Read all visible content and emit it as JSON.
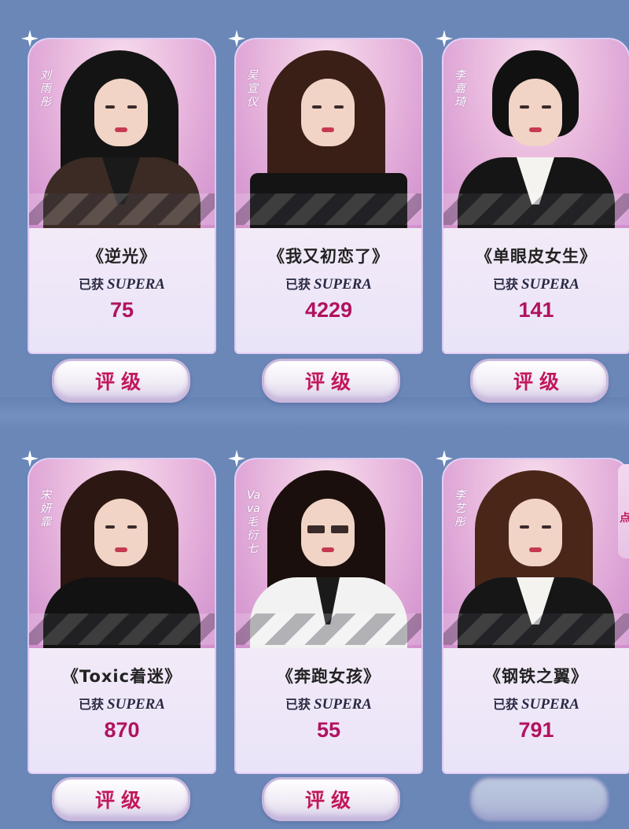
{
  "cards": [
    {
      "name": "刘雨彤",
      "song": "《逆光》",
      "got_label": "已获",
      "badge": "SUPERA",
      "count": "75",
      "button": "评级"
    },
    {
      "name": "吴宣仪",
      "song": "《我又初恋了》",
      "got_label": "已获",
      "badge": "SUPERA",
      "count": "4229",
      "button": "评级"
    },
    {
      "name": "李嘉琦",
      "song": "《单眼皮女生》",
      "got_label": "已获",
      "badge": "SUPERA",
      "count": "141",
      "button": "评级"
    },
    {
      "name": "宋妍霏",
      "song": "《Toxic着迷》",
      "got_label": "已获",
      "badge": "SUPERA",
      "count": "870",
      "button": "评级"
    },
    {
      "name": "Vava毛衍七",
      "song": "《奔跑女孩》",
      "got_label": "已获",
      "badge": "SUPERA",
      "count": "55",
      "button": "评级"
    },
    {
      "name": "李艺彤",
      "song": "《钢铁之翼》",
      "got_label": "已获",
      "badge": "SUPERA",
      "count": "791",
      "button": ""
    }
  ],
  "side_peek_text": "点",
  "colors": {
    "background": "#6a87b8",
    "count": "#b1125e",
    "button_text": "#c2185b"
  }
}
